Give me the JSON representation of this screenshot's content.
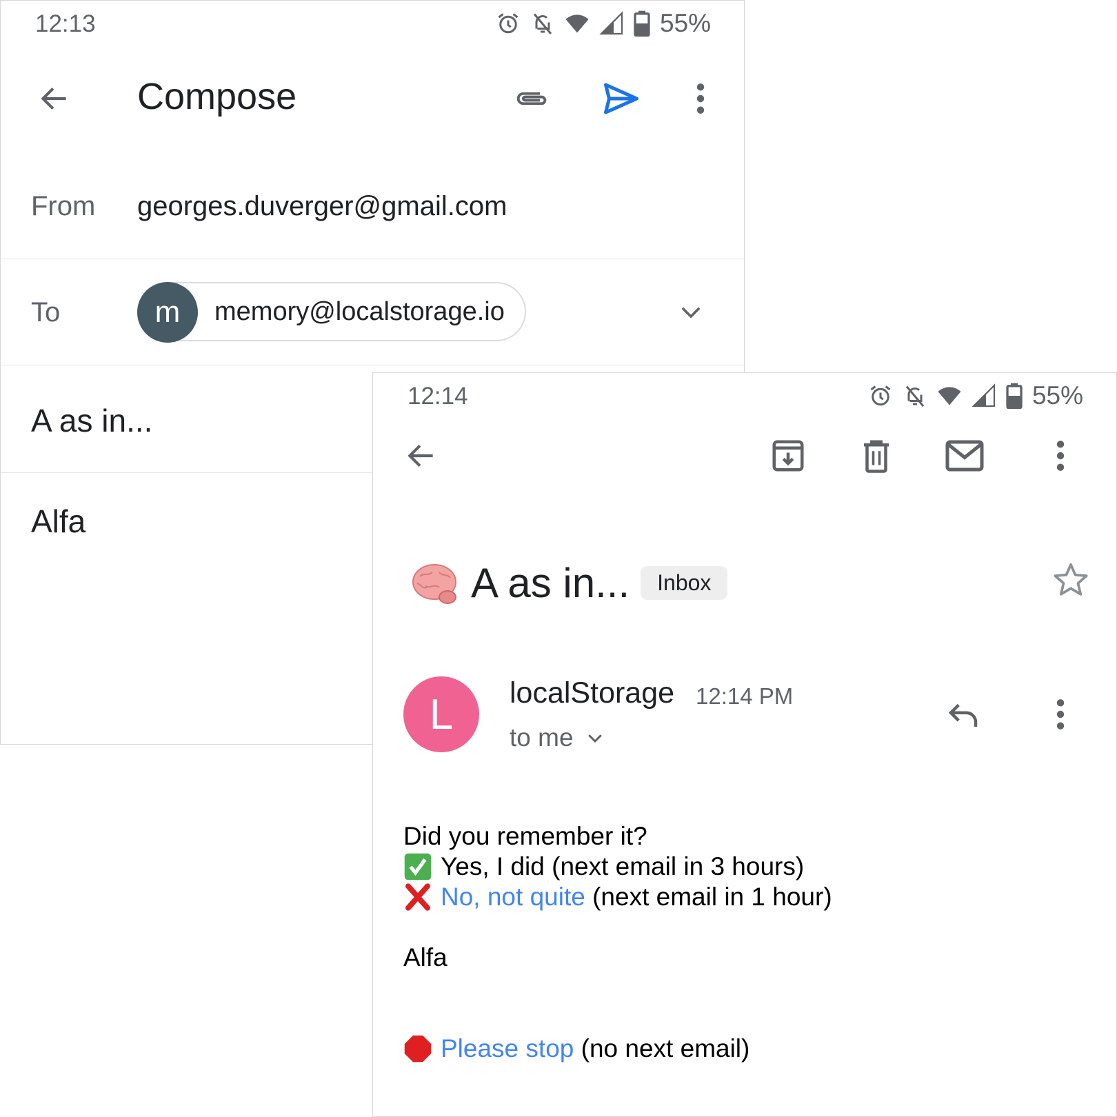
{
  "compose_screen": {
    "status_bar": {
      "time": "12:13",
      "battery": "55%",
      "icons": [
        "alarm-icon",
        "notifications-off-icon",
        "wifi-icon",
        "cell-signal-icon",
        "battery-icon"
      ]
    },
    "toolbar": {
      "title": "Compose",
      "icons": [
        "back-arrow-icon",
        "attach-icon",
        "send-icon",
        "more-vert-icon"
      ]
    },
    "from": {
      "label": "From",
      "value": "georges.duverger@gmail.com"
    },
    "to": {
      "label": "To",
      "chip_initial": "m",
      "chip_email": "memory@localstorage.io"
    },
    "subject": "A as in...",
    "body": "Alfa",
    "colors": {
      "send_icon": "#1a73e8",
      "chip_avatar": "#455a64"
    }
  },
  "message_screen": {
    "status_bar": {
      "time": "12:14",
      "battery": "55%",
      "icons": [
        "alarm-icon",
        "notifications-off-icon",
        "wifi-icon",
        "cell-signal-icon",
        "battery-icon"
      ]
    },
    "toolbar": {
      "icons": [
        "back-arrow-icon",
        "archive-icon",
        "delete-icon",
        "mark-unread-icon",
        "more-vert-icon"
      ]
    },
    "subject": {
      "emoji": "brain",
      "text": "A as in...",
      "label": "Inbox"
    },
    "sender": {
      "initial": "L",
      "name": "localStorage",
      "time": "12:14 PM",
      "recipient": "to me"
    },
    "body": {
      "question": "Did you remember it?",
      "yes_text": "Yes, I did (next email in 3 hours)",
      "no_link": "No, not quite",
      "no_suffix": " (next email in 1 hour)",
      "answer": "Alfa",
      "stop_link": "Please stop",
      "stop_suffix": " (no next email)"
    },
    "colors": {
      "sender_avatar": "#f06292",
      "link": "#4285f4"
    }
  }
}
